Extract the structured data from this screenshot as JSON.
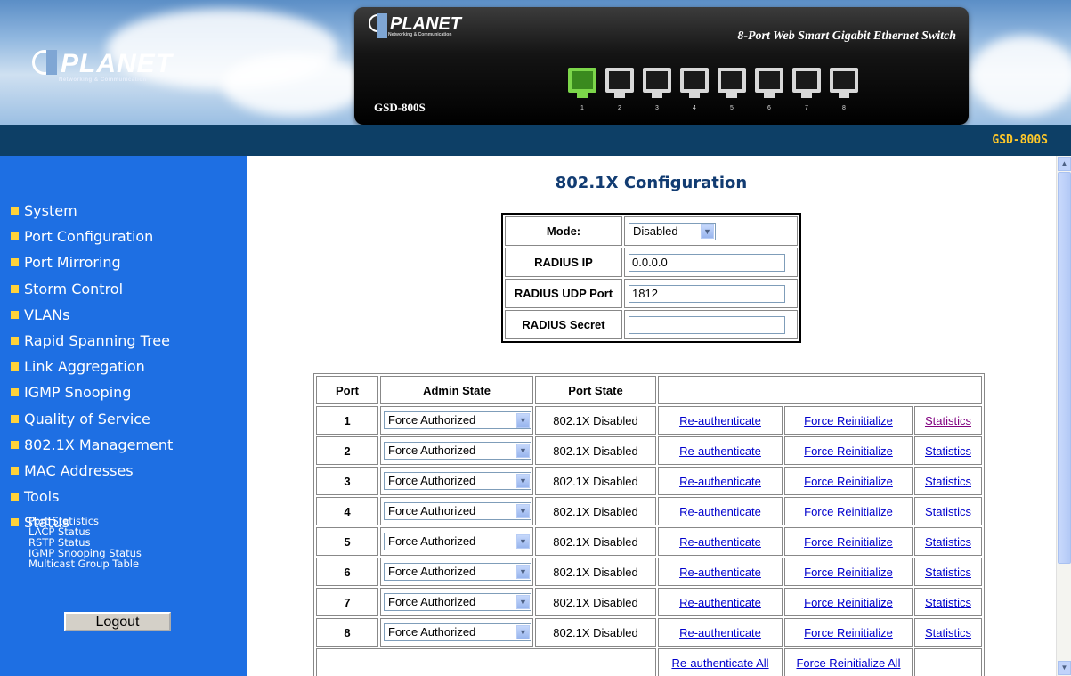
{
  "brand": {
    "logo": "PLANET",
    "logo_tagline": "Networking & Communication"
  },
  "device": {
    "logo": "PLANET",
    "logo_tagline": "Networking & Communication",
    "title": "8-Port Web Smart Gigabit Ethernet Switch",
    "model": "GSD-800S",
    "ports": [
      "1",
      "2",
      "3",
      "4",
      "5",
      "6",
      "7",
      "8"
    ],
    "active_port": "1"
  },
  "topbar": {
    "model": "GSD-800S"
  },
  "nav": {
    "items": [
      "System",
      "Port Configuration",
      "Port Mirroring",
      "Storm Control",
      "VLANs",
      "Rapid Spanning Tree",
      "Link Aggregation",
      "IGMP Snooping",
      "Quality of Service",
      "802.1X Management",
      "MAC Addresses",
      "Tools",
      "Status"
    ],
    "status_subitems": [
      "Port Statistics",
      "LACP Status",
      "RSTP Status",
      "IGMP Snooping Status",
      "Multicast Group Table"
    ],
    "logout_label": "Logout"
  },
  "page": {
    "title": "802.1X Configuration",
    "config": {
      "mode_label": "Mode:",
      "mode_value": "Disabled",
      "radius_ip_label": "RADIUS IP",
      "radius_ip_value": "0.0.0.0",
      "radius_udp_port_label": "RADIUS UDP Port",
      "radius_udp_port_value": "1812",
      "radius_secret_label": "RADIUS Secret",
      "radius_secret_value": ""
    },
    "port_table": {
      "headers": {
        "port": "Port",
        "admin_state": "Admin State",
        "port_state": "Port State"
      },
      "rows": [
        {
          "port": "1",
          "admin_state": "Force Authorized",
          "port_state": "802.1X Disabled",
          "reauth": "Re-authenticate",
          "reinit": "Force Reinitialize",
          "stats": "Statistics"
        },
        {
          "port": "2",
          "admin_state": "Force Authorized",
          "port_state": "802.1X Disabled",
          "reauth": "Re-authenticate",
          "reinit": "Force Reinitialize",
          "stats": "Statistics"
        },
        {
          "port": "3",
          "admin_state": "Force Authorized",
          "port_state": "802.1X Disabled",
          "reauth": "Re-authenticate",
          "reinit": "Force Reinitialize",
          "stats": "Statistics"
        },
        {
          "port": "4",
          "admin_state": "Force Authorized",
          "port_state": "802.1X Disabled",
          "reauth": "Re-authenticate",
          "reinit": "Force Reinitialize",
          "stats": "Statistics"
        },
        {
          "port": "5",
          "admin_state": "Force Authorized",
          "port_state": "802.1X Disabled",
          "reauth": "Re-authenticate",
          "reinit": "Force Reinitialize",
          "stats": "Statistics"
        },
        {
          "port": "6",
          "admin_state": "Force Authorized",
          "port_state": "802.1X Disabled",
          "reauth": "Re-authenticate",
          "reinit": "Force Reinitialize",
          "stats": "Statistics"
        },
        {
          "port": "7",
          "admin_state": "Force Authorized",
          "port_state": "802.1X Disabled",
          "reauth": "Re-authenticate",
          "reinit": "Force Reinitialize",
          "stats": "Statistics"
        },
        {
          "port": "8",
          "admin_state": "Force Authorized",
          "port_state": "802.1X Disabled",
          "reauth": "Re-authenticate",
          "reinit": "Force Reinitialize",
          "stats": "Statistics"
        }
      ],
      "reauth_all": "Re-authenticate All",
      "reinit_all": "Force Reinitialize All"
    }
  },
  "colors": {
    "topbar": "#0d3f66",
    "sidebar": "#1e6fe3",
    "accent_yellow": "#ffc82a",
    "title_blue": "#123c72",
    "link": "#0000cc",
    "visited_link": "#800080"
  },
  "icons": {
    "nav_bullet": "yellow-square-icon",
    "select_arrow": "chevron-down-icon",
    "port": "ethernet-port-icon"
  }
}
